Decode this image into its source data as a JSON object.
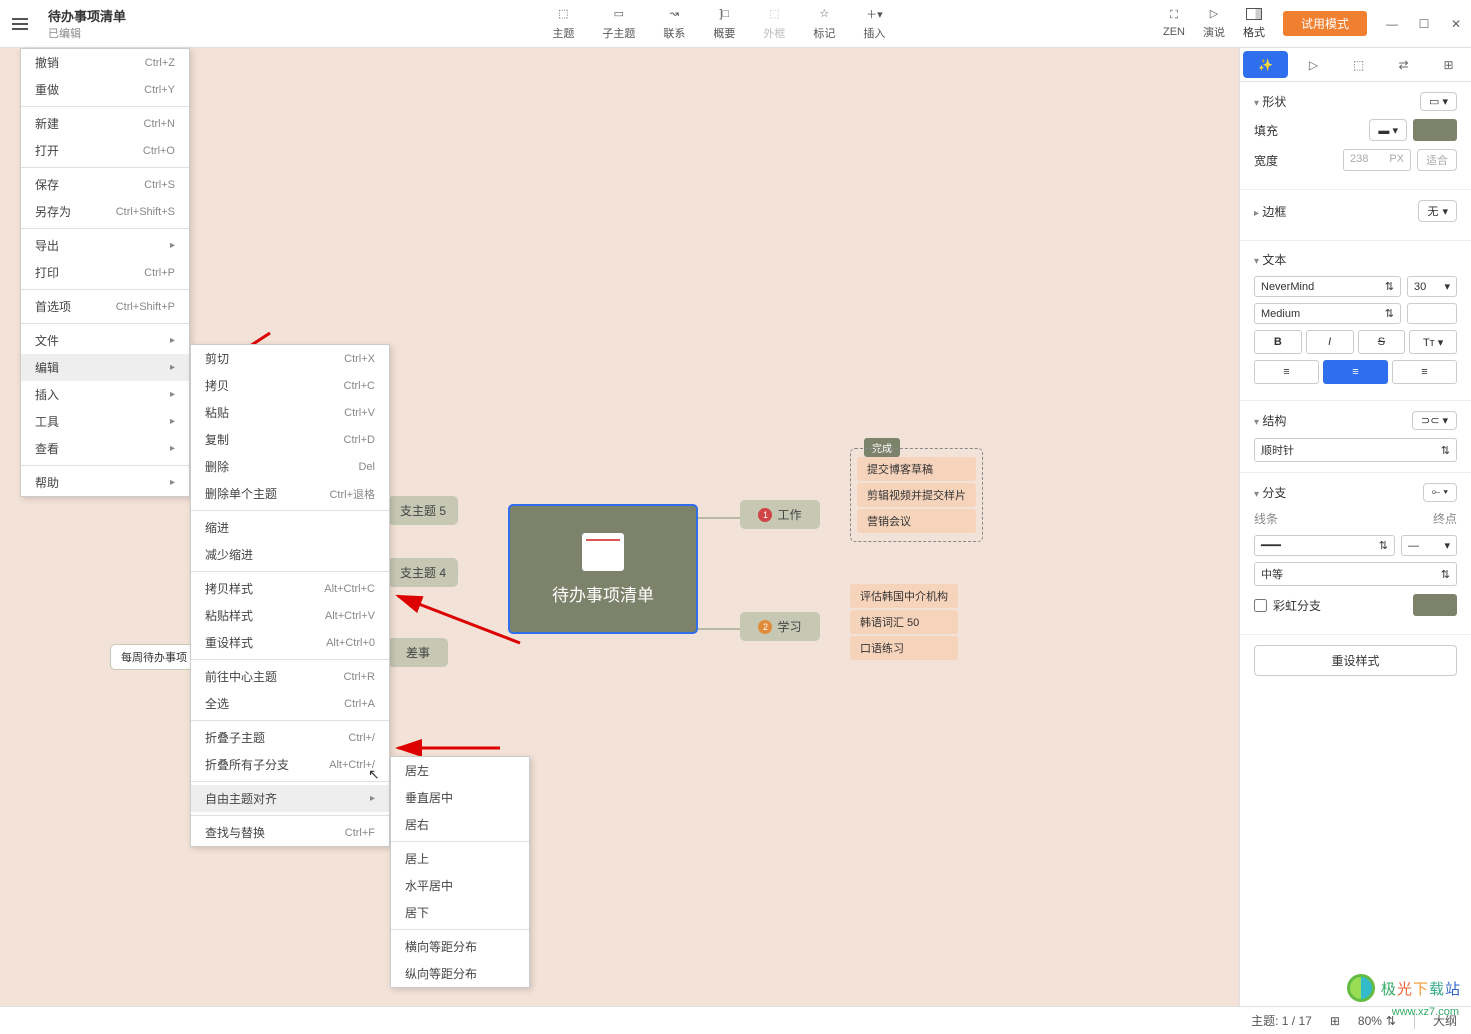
{
  "header": {
    "title": "待办事项清单",
    "subtitle": "已编辑",
    "toolbar": [
      {
        "label": "主题"
      },
      {
        "label": "子主题"
      },
      {
        "label": "联系"
      },
      {
        "label": "概要"
      },
      {
        "label": "外框",
        "disabled": true
      },
      {
        "label": "标记"
      },
      {
        "label": "插入"
      }
    ],
    "right": {
      "zen": "ZEN",
      "present": "演说",
      "format": "格式",
      "trial": "试用模式"
    }
  },
  "file_menu": {
    "undo": {
      "label": "撤销",
      "key": "Ctrl+Z"
    },
    "redo": {
      "label": "重做",
      "key": "Ctrl+Y"
    },
    "new": {
      "label": "新建",
      "key": "Ctrl+N"
    },
    "open": {
      "label": "打开",
      "key": "Ctrl+O"
    },
    "save": {
      "label": "保存",
      "key": "Ctrl+S"
    },
    "saveas": {
      "label": "另存为",
      "key": "Ctrl+Shift+S"
    },
    "export": {
      "label": "导出"
    },
    "print": {
      "label": "打印",
      "key": "Ctrl+P"
    },
    "pref": {
      "label": "首选项",
      "key": "Ctrl+Shift+P"
    },
    "file": {
      "label": "文件"
    },
    "edit": {
      "label": "编辑"
    },
    "insert": {
      "label": "插入"
    },
    "tools": {
      "label": "工具"
    },
    "view": {
      "label": "查看"
    },
    "help": {
      "label": "帮助"
    }
  },
  "edit_menu": {
    "cut": {
      "label": "剪切",
      "key": "Ctrl+X"
    },
    "copy": {
      "label": "拷贝",
      "key": "Ctrl+C"
    },
    "paste": {
      "label": "粘贴",
      "key": "Ctrl+V"
    },
    "duplicate": {
      "label": "复制",
      "key": "Ctrl+D"
    },
    "delete": {
      "label": "删除",
      "key": "Del"
    },
    "delete_single": {
      "label": "删除单个主题",
      "key": "Ctrl+退格"
    },
    "indent": {
      "label": "缩进"
    },
    "outdent": {
      "label": "减少缩进"
    },
    "copy_style": {
      "label": "拷贝样式",
      "key": "Alt+Ctrl+C"
    },
    "paste_style": {
      "label": "粘贴样式",
      "key": "Alt+Ctrl+V"
    },
    "reset_style": {
      "label": "重设样式",
      "key": "Alt+Ctrl+0"
    },
    "goto_center": {
      "label": "前往中心主题",
      "key": "Ctrl+R"
    },
    "select_all": {
      "label": "全选",
      "key": "Ctrl+A"
    },
    "fold_sub": {
      "label": "折叠子主题",
      "key": "Ctrl+/"
    },
    "fold_all": {
      "label": "折叠所有子分支",
      "key": "Alt+Ctrl+/"
    },
    "align_free": {
      "label": "自由主题对齐"
    },
    "find": {
      "label": "查找与替换",
      "key": "Ctrl+F"
    }
  },
  "align_menu": {
    "left": "居左",
    "vcenter": "垂直居中",
    "right": "居右",
    "top": "居上",
    "hcenter": "水平居中",
    "bottom": "居下",
    "hdist": "横向等距分布",
    "vdist": "纵向等距分布"
  },
  "mindmap": {
    "central": "待办事项清单",
    "sub5": "支主题 5",
    "sub4": "支主题 4",
    "diff": "差事",
    "weekly": "每周待办事项",
    "work": "工作",
    "study": "学习",
    "done_tag": "完成",
    "work_items": [
      "提交博客草稿",
      "剪辑视频并提交样片",
      "营销会议"
    ],
    "study_items": [
      "评估韩国中介机构",
      "韩语词汇 50",
      "口语练习"
    ]
  },
  "panel": {
    "shape": {
      "title": "形状"
    },
    "fill": {
      "label": "填充"
    },
    "width": {
      "label": "宽度",
      "value": "238",
      "unit": "PX",
      "fit": "适合"
    },
    "border": {
      "title": "边框",
      "value": "无"
    },
    "text": {
      "title": "文本",
      "font": "NeverMind",
      "size": "30",
      "weight": "Medium"
    },
    "structure": {
      "title": "结构",
      "value": "顺时针"
    },
    "branch": {
      "title": "分支",
      "line_label": "线条",
      "end_label": "终点",
      "width": "中等",
      "rainbow": "彩虹分支"
    },
    "reset": "重设样式"
  },
  "status": {
    "topics": "主题: 1 / 17",
    "zoom": "80%",
    "outline": "大纲"
  },
  "watermark": {
    "text": "极光下载站",
    "url": "www.xz7.com"
  }
}
